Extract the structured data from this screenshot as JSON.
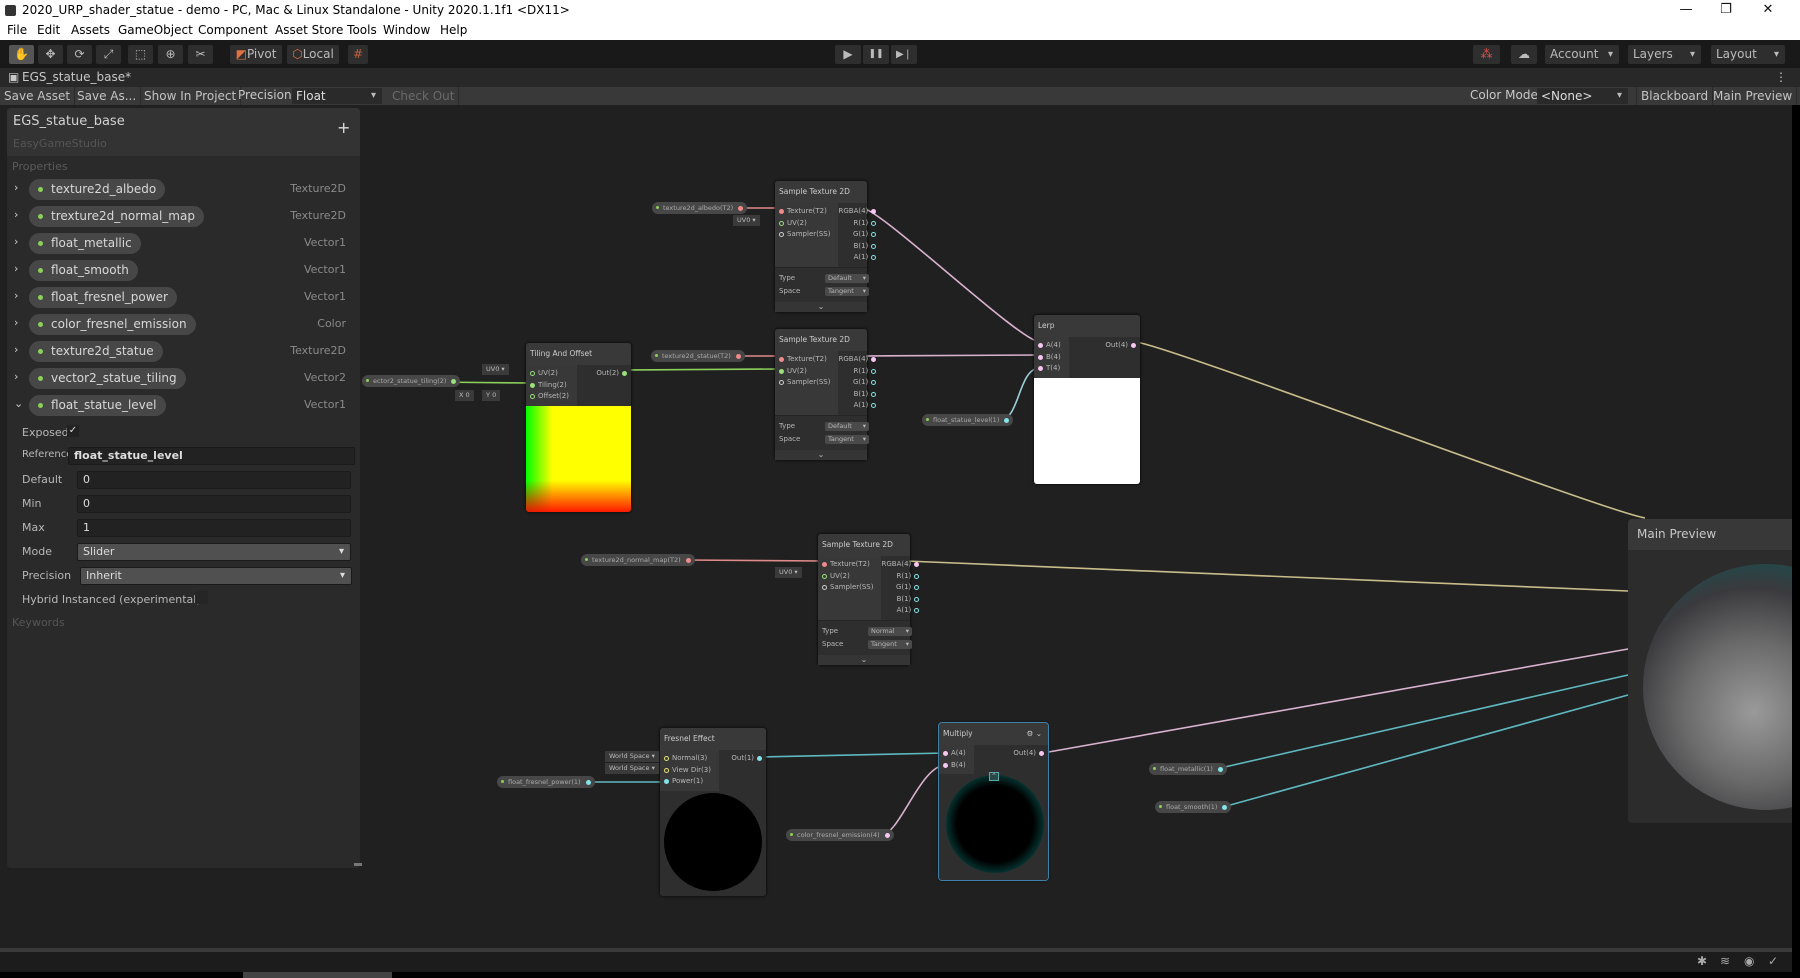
{
  "window": {
    "title": "2020_URP_shader_statue - demo - PC, Mac & Linux Standalone - Unity 2020.1.1f1 <DX11>",
    "minimize": "—",
    "maximize": "❐",
    "close": "✕"
  },
  "menu": [
    "File",
    "Edit",
    "Assets",
    "GameObject",
    "Component",
    "Asset Store Tools",
    "Window",
    "Help"
  ],
  "toolbar": {
    "tools": [
      "hand-tool",
      "move-tool",
      "rotate-tool",
      "scale-tool",
      "rect-tool",
      "transform-tool",
      "custom-tool"
    ],
    "tool_glyphs": [
      "✋",
      "✥",
      "⟳",
      "⤢",
      "⬚",
      "⊕",
      "✂"
    ],
    "pivot": "Pivot",
    "local": "Local",
    "play": "▶",
    "pause": "❚❚",
    "step": "▶❘",
    "account": "Account",
    "layers": "Layers",
    "layout": "Layout"
  },
  "tab": {
    "title": "EGS_statue_base*",
    "menu": "⋮"
  },
  "graph_toolbar": {
    "save_asset": "Save Asset",
    "save_as": "Save As...",
    "show_in_project": "Show In Project",
    "precision_label": "Precision",
    "precision_value": "Float",
    "check_out": "Check Out",
    "color_mode_label": "Color Mode",
    "color_mode_value": "<None>",
    "blackboard": "Blackboard",
    "main_preview": "Main Preview"
  },
  "blackboard": {
    "title": "EGS_statue_base",
    "subtitle": "EasyGameStudio",
    "add": "+",
    "section": "Properties",
    "properties": [
      {
        "name": "texture2d_albedo",
        "type": "Texture2D",
        "expanded": false
      },
      {
        "name": "trexture2d_normal_map",
        "type": "Texture2D",
        "expanded": false
      },
      {
        "name": "float_metallic",
        "type": "Vector1",
        "expanded": false
      },
      {
        "name": "float_smooth",
        "type": "Vector1",
        "expanded": false
      },
      {
        "name": "float_fresnel_power",
        "type": "Vector1",
        "expanded": false
      },
      {
        "name": "color_fresnel_emission",
        "type": "Color",
        "expanded": false
      },
      {
        "name": "texture2d_statue",
        "type": "Texture2D",
        "expanded": false
      },
      {
        "name": "vector2_statue_tiling",
        "type": "Vector2",
        "expanded": false
      },
      {
        "name": "float_statue_level",
        "type": "Vector1",
        "expanded": true
      }
    ],
    "detail": {
      "exposed_label": "Exposed",
      "exposed": true,
      "reference_label": "Reference",
      "reference": "float_statue_level",
      "default_label": "Default",
      "default": "0",
      "min_label": "Min",
      "min": "0",
      "max_label": "Max",
      "max": "1",
      "mode_label": "Mode",
      "mode": "Slider",
      "precision_label": "Precision",
      "precision": "Inherit",
      "hybrid_label": "Hybrid Instanced (experimental)",
      "hybrid": false
    },
    "keywords": "Keywords"
  },
  "colors": {
    "texture": "#f08a8a",
    "vector1": "#84e4e7",
    "vector2": "#9be07a",
    "vector4": "#f5c6f0",
    "sampler": "#cccccc",
    "vector3": "#e8e36e"
  },
  "nodes": [
    {
      "id": "sample_albedo",
      "title": "Sample Texture 2D",
      "inputs": [
        [
          "Texture(T2)",
          "texture",
          false
        ],
        [
          "UV(2)",
          "vector2",
          true
        ],
        [
          "Sampler(SS)",
          "sampler",
          true
        ]
      ],
      "outputs": [
        [
          "RGBA(4)",
          "vector4"
        ],
        [
          "R(1)",
          "vector1"
        ],
        [
          "G(1)",
          "vector1"
        ],
        [
          "B(1)",
          "vector1"
        ],
        [
          "A(1)",
          "vector1"
        ]
      ],
      "fields": [
        [
          "Type",
          "Default"
        ],
        [
          "Space",
          "Tangent"
        ]
      ],
      "chevron": "⌄"
    },
    {
      "id": "sample_statue",
      "title": "Sample Texture 2D",
      "inputs": [
        [
          "Texture(T2)",
          "texture",
          false
        ],
        [
          "UV(2)",
          "vector2",
          false
        ],
        [
          "Sampler(SS)",
          "sampler",
          true
        ]
      ],
      "outputs": [
        [
          "RGBA(4)",
          "vector4"
        ],
        [
          "R(1)",
          "vector1"
        ],
        [
          "G(1)",
          "vector1"
        ],
        [
          "B(1)",
          "vector1"
        ],
        [
          "A(1)",
          "vector1"
        ]
      ],
      "fields": [
        [
          "Type",
          "Default"
        ],
        [
          "Space",
          "Tangent"
        ]
      ],
      "chevron": "⌄"
    },
    {
      "id": "sample_normal",
      "title": "Sample Texture 2D",
      "inputs": [
        [
          "Texture(T2)",
          "texture",
          false
        ],
        [
          "UV(2)",
          "vector2",
          true
        ],
        [
          "Sampler(SS)",
          "sampler",
          true
        ]
      ],
      "outputs": [
        [
          "RGBA(4)",
          "vector4"
        ],
        [
          "R(1)",
          "vector1"
        ],
        [
          "G(1)",
          "vector1"
        ],
        [
          "B(1)",
          "vector1"
        ],
        [
          "A(1)",
          "vector1"
        ]
      ],
      "fields": [
        [
          "Type",
          "Normal"
        ],
        [
          "Space",
          "Tangent"
        ]
      ],
      "chevron": "⌄"
    },
    {
      "id": "tiling_offset",
      "title": "Tiling And Offset",
      "inputs": [
        [
          "UV(2)",
          "vector2",
          true
        ],
        [
          "Tiling(2)",
          "vector2",
          false
        ],
        [
          "Offset(2)",
          "vector2",
          true
        ]
      ],
      "outputs": [
        [
          "Out(2)",
          "vector2"
        ]
      ],
      "preview": "uv-gradient"
    },
    {
      "id": "lerp",
      "title": "Lerp",
      "inputs": [
        [
          "A(4)",
          "vector4",
          false
        ],
        [
          "B(4)",
          "vector4",
          false
        ],
        [
          "T(4)",
          "vector4",
          false
        ]
      ],
      "outputs": [
        [
          "Out(4)",
          "vector4"
        ]
      ],
      "preview": "white"
    },
    {
      "id": "fresnel",
      "title": "Fresnel Effect",
      "inputs": [
        [
          "Normal(3)",
          "vector3",
          true
        ],
        [
          "View Dir(3)",
          "vector3",
          true
        ],
        [
          "Power(1)",
          "vector1",
          false
        ]
      ],
      "outputs": [
        [
          "Out(1)",
          "vector1"
        ]
      ],
      "preview": "fresnel-sphere"
    },
    {
      "id": "multiply",
      "title": "Multiply",
      "inputs": [
        [
          "A(4)",
          "vector4",
          false
        ],
        [
          "B(4)",
          "vector4",
          false
        ]
      ],
      "outputs": [
        [
          "Out(4)",
          "vector4"
        ]
      ],
      "preview": "cyan-rim-sphere",
      "selected": true,
      "header_icons": "⚙ ⌄"
    }
  ],
  "graph_properties": [
    {
      "id": "p_albedo",
      "label": "texture2d_albedo(T2)",
      "type": "texture"
    },
    {
      "id": "p_statue",
      "label": "texture2d_statue(T2)",
      "type": "texture"
    },
    {
      "id": "p_tiling",
      "label": "ector2_statue_tiling(2)",
      "type": "vector2"
    },
    {
      "id": "p_level",
      "label": "float_statue_level(1)",
      "type": "vector1"
    },
    {
      "id": "p_normal",
      "label": "texture2d_normal_map(T2)",
      "type": "texture"
    },
    {
      "id": "p_fpower",
      "label": "float_fresnel_power(1)",
      "type": "vector1"
    },
    {
      "id": "p_emission",
      "label": "color_fresnel_emission(4)",
      "type": "vector4"
    },
    {
      "id": "p_metallic",
      "label": "float_metallic(1)",
      "type": "vector1"
    },
    {
      "id": "p_smooth",
      "label": "float_smooth(1)",
      "type": "vector1"
    }
  ],
  "inline_chips": {
    "uv0": "UV0 ▾",
    "x_label": "X",
    "x_value": "0",
    "y_label": "Y",
    "y_value": "0",
    "world_space": "World Space ▾"
  },
  "main_preview": {
    "title": "Main Preview"
  },
  "status_icons": [
    "bug-icon",
    "database-icon",
    "lightbulb-icon",
    "check-circle-icon"
  ]
}
